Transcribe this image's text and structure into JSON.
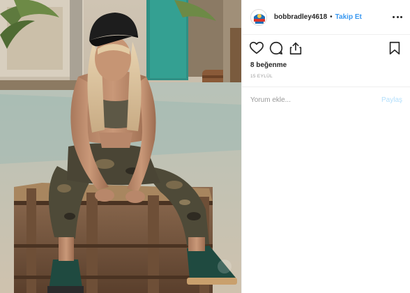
{
  "post": {
    "username": "bobbradley4618",
    "separator": "•",
    "follow_label": "Takip Et",
    "likes_text": "8 beğenme",
    "date_text": "15 EYLÜL",
    "comment_placeholder": "Yorum ekle...",
    "post_label": "Paylaş"
  },
  "icons": {
    "more": "more-options-icon",
    "like": "heart-icon",
    "comment": "comment-icon",
    "share": "share-icon",
    "save": "bookmark-icon"
  },
  "colors": {
    "link": "#3897f0",
    "text": "#262626",
    "muted": "#999999",
    "post_disabled": "#b2dffc"
  }
}
